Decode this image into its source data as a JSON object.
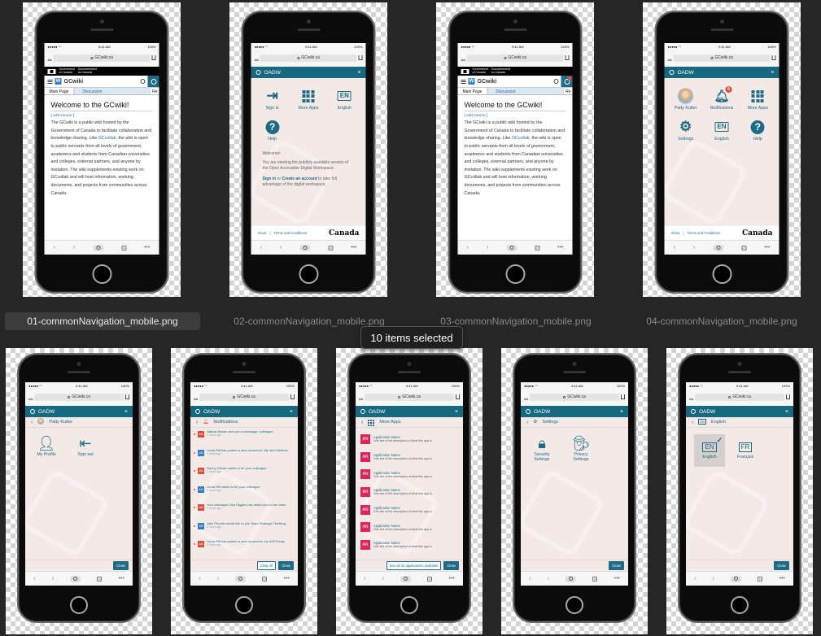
{
  "selection_label": "10 items selected",
  "files": [
    {
      "name": "01-commonNavigation_mobile.png",
      "selected": true
    },
    {
      "name": "02-commonNavigation_mobile.png",
      "selected": false
    },
    {
      "name": "03-commonNavigation_mobile.png",
      "selected": false
    },
    {
      "name": "04-commonNavigation_mobile.png",
      "selected": false
    }
  ],
  "browser": {
    "time": "9:41 AM",
    "battery": "100%",
    "url": "GCwiki.ca"
  },
  "gov_banner": {
    "line1": "Government",
    "line2": "of Canada",
    "line3": "Gouvernement",
    "line4": "du Canada"
  },
  "wiki": {
    "name": "GCwiki",
    "tabs": [
      "Main Page",
      "Discussion",
      "Re"
    ],
    "title": "Welcome to the GCwiki!",
    "edit": "[ edit source ]",
    "body_a": "The GCwiki is a public wiki hosted by the Government of Canada to facilitate collaboration and knowledge sharing. Like ",
    "body_link": "GCcollab",
    "body_b": ", the wiki is open to public servants from all levels of government, academics and students from Canadian universities and colleges, external partners, and anyone by invitation. The wiki supplements existing work on GCcollab and will host information, working documents, and projects from communities across Canada."
  },
  "oadw": {
    "title": "OADW",
    "close": "×"
  },
  "menu_anon": {
    "items": [
      {
        "label": "Sign in"
      },
      {
        "label": "More Apps"
      },
      {
        "label": "English",
        "badge": "EN"
      },
      {
        "label": "Help"
      }
    ],
    "welcome_title": "Welcome!",
    "welcome_text": "You are viewing the publicly available version of the Open Accessible Digital Workspace.",
    "signin": "Sign in",
    "or": " or ",
    "create": "Create an account",
    "tail": " to take full advantage of the digital workspace."
  },
  "footer": {
    "about": "About",
    "sep": "|",
    "terms": "Terms and Conditions",
    "canada": "Canada"
  },
  "menu_user": {
    "items": [
      {
        "label": "Patty Kutter"
      },
      {
        "label": "Notifications",
        "badge": "6"
      },
      {
        "label": "More Apps"
      },
      {
        "label": "Settings"
      },
      {
        "label": "English",
        "badge": "EN"
      },
      {
        "label": "Help"
      }
    ]
  },
  "profile": {
    "back": "‹",
    "name": "Patty Kutter",
    "items": [
      "My Profile",
      "Sign out"
    ]
  },
  "notifications": {
    "title": "Notifications",
    "rows": [
      {
        "av": "AN",
        "text": "Nathan Brown sent you a message: colleague",
        "meta": "2 hours ago"
      },
      {
        "av": "AN",
        "text": "Linda Riff has posted a new document: My new Webinar",
        "meta": "2 hours ago"
      },
      {
        "av": "AN",
        "text": "Danny Zeidan wants to be your colleague",
        "meta": "2 hours ago"
      },
      {
        "av": "AN",
        "text": "Linda Riff wants to be your colleague",
        "meta": "2 hours ago"
      },
      {
        "av": "AN",
        "text": "Your colleague Lisa Higgins has asked you to her team.",
        "meta": "2 hours ago"
      },
      {
        "av": "AN",
        "text": "Julie Phoulls would like to join Team Strategic Thinking.",
        "meta": "2 hours ago"
      },
      {
        "av": "AN",
        "text": "Linda Riff has posted a new document: my #GCFriday",
        "meta": "2 hours ago"
      }
    ],
    "clear": "Clear All",
    "close": "Close"
  },
  "more_apps": {
    "title": "More Apps",
    "rows": [
      {
        "av": "AN",
        "name": "Application Name",
        "desc": "One line of the description of what this app is."
      },
      {
        "av": "AN",
        "name": "Application Name",
        "desc": "One line of the description of what this app is."
      },
      {
        "av": "AN",
        "name": "Application Name",
        "desc": "One line of the description of what this app is."
      },
      {
        "av": "AN",
        "name": "Application Name",
        "desc": "One line of the description of what this app is."
      },
      {
        "av": "AN",
        "name": "Application Name",
        "desc": "One line of the description of what this app is."
      },
      {
        "av": "AN",
        "name": "Application Name",
        "desc": "One line of the description of what this app is."
      },
      {
        "av": "AN",
        "name": "Application Name",
        "desc": "One line of the description of what this app is."
      }
    ],
    "see_all": "See all 32 applications available",
    "close": "Close"
  },
  "settings": {
    "title": "Settings",
    "items": [
      "Security Settings",
      "Privacy Settings"
    ],
    "close": "Close"
  },
  "language": {
    "title": "English",
    "options": [
      {
        "badge": "EN",
        "label": "English",
        "selected": true
      },
      {
        "badge": "FR",
        "label": "Français",
        "selected": false
      }
    ],
    "close": "Close"
  },
  "close_label": "Close",
  "colors": {
    "oadw": "#16697e",
    "panel": "#f3e9e6",
    "accent": "#1e6b86",
    "badge": "#e34b3a",
    "app": "#e0245e"
  }
}
